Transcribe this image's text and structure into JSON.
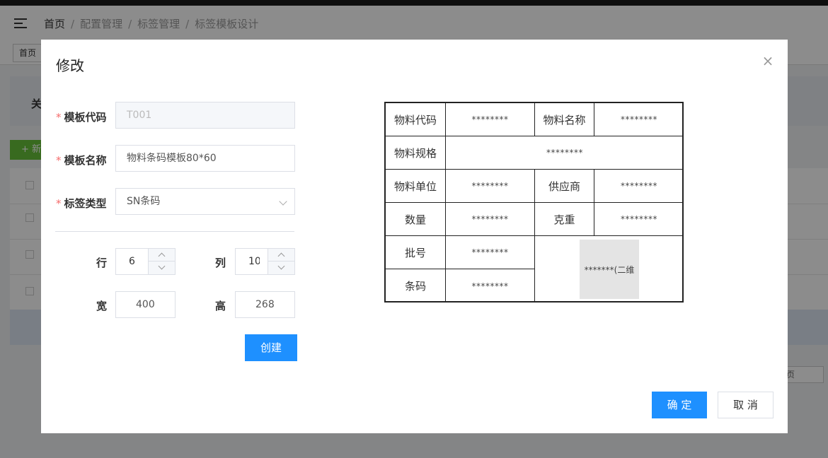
{
  "background": {
    "breadcrumb": [
      "首页",
      "配置管理",
      "标签管理",
      "标签模板设计"
    ],
    "tag_home": "首页",
    "panel_text": "关",
    "add_button": "+ 新",
    "pager_text": "页"
  },
  "dialog": {
    "title": "修改",
    "close_icon": "×",
    "fields": {
      "template_code": {
        "label": "模板代码",
        "value": "T001"
      },
      "template_name": {
        "label": "模板名称",
        "value": "物料条码模板80*60"
      },
      "label_type": {
        "label": "标签类型",
        "value": "SN条码"
      },
      "rows": {
        "label": "行",
        "value": "6"
      },
      "cols": {
        "label": "列",
        "value": "10"
      },
      "width": {
        "label": "宽",
        "value": "400"
      },
      "height": {
        "label": "高",
        "value": "268"
      }
    },
    "create_button": "创建",
    "confirm_button": "确 定",
    "cancel_button": "取 消"
  },
  "preview": {
    "placeholder": "********",
    "labels": {
      "material_code": "物料代码",
      "material_name": "物料名称",
      "material_spec": "物料规格",
      "material_unit": "物料单位",
      "supplier": "供应商",
      "quantity": "数量",
      "gram_weight": "克重",
      "batch_no": "批号",
      "barcode": "条码"
    },
    "qr_text": "*******(二维"
  },
  "colors": {
    "primary": "#1e90ff",
    "required": "#f56c6c",
    "add_green": "#67c23a"
  }
}
